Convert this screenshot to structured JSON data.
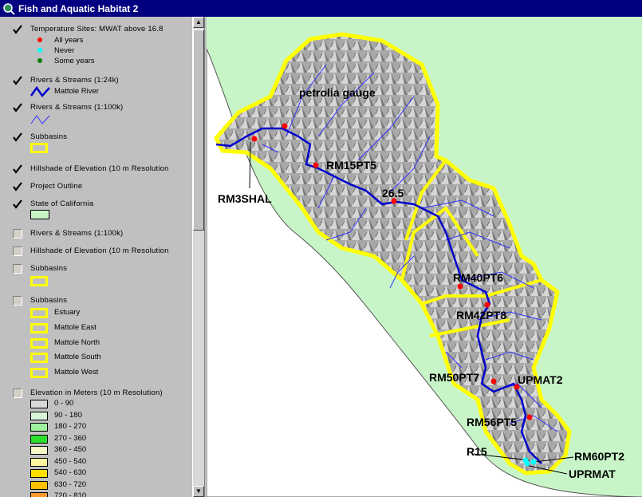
{
  "window": {
    "title": "Fish and Aquatic Habitat 2"
  },
  "toc": {
    "temp_sites": {
      "label": "Temperature Sites: MWAT above 16.8",
      "items": [
        {
          "label": "All years",
          "color": "#ff0000"
        },
        {
          "label": "Never",
          "color": "#00ffff"
        },
        {
          "label": "Some years",
          "color": "#008000"
        }
      ]
    },
    "rivers_24k": {
      "label": "Rivers & Streams (1:24k)",
      "item": "Mattole River"
    },
    "rivers_100k": {
      "label": "Rivers & Streams (1:100k)"
    },
    "subbasins": {
      "label": "Subbasins"
    },
    "hillshade": {
      "label": "Hillshade of Elevation (10 m Resolution"
    },
    "outline": {
      "label": "Project Outline"
    },
    "state": {
      "label": "State of California"
    },
    "rivers_100k_off": {
      "label": "Rivers & Streams (1:100k)"
    },
    "hillshade_off": {
      "label": "Hillshade of Elevation (10 m Resolution"
    },
    "subbasins_off": {
      "label": "Subbasins"
    },
    "subbasins_named": {
      "label": "Subbasins",
      "items": [
        "Estuary",
        "Mattole East",
        "Mattole North",
        "Mattole South",
        "Mattole West"
      ]
    },
    "elevation": {
      "label": "Elevation in Meters (10 m Resolution)",
      "classes": [
        {
          "label": "0 - 90",
          "color": "#d9d9d9"
        },
        {
          "label": "90 - 180",
          "color": "#d9f5d9"
        },
        {
          "label": "180 - 270",
          "color": "#9ef09e"
        },
        {
          "label": "270 - 360",
          "color": "#2ee02e"
        },
        {
          "label": "360 - 450",
          "color": "#f7f7c8"
        },
        {
          "label": "450 - 540",
          "color": "#fff4a0"
        },
        {
          "label": "540 - 630",
          "color": "#ffe000"
        },
        {
          "label": "630 - 720",
          "color": "#ffc000"
        },
        {
          "label": "720 - 810",
          "color": "#ff9a30"
        }
      ]
    }
  },
  "map": {
    "colors": {
      "land": "#c8f5c8",
      "ocean": "#ffffff",
      "outline": "#ffff00",
      "river": "#0000cc",
      "site": "#ff0000"
    },
    "sites": [
      {
        "label": "petrolia gauge"
      },
      {
        "label": "RM3SHAL"
      },
      {
        "label": "RM15PT5"
      },
      {
        "label": "26.5"
      },
      {
        "label": "RM40PT6"
      },
      {
        "label": "RM42PT8"
      },
      {
        "label": "RM50PT7"
      },
      {
        "label": "UPMAT2"
      },
      {
        "label": "RM56PT5"
      },
      {
        "label": "R15"
      },
      {
        "label": "RM60PT2"
      },
      {
        "label": "UPRMAT"
      }
    ]
  }
}
